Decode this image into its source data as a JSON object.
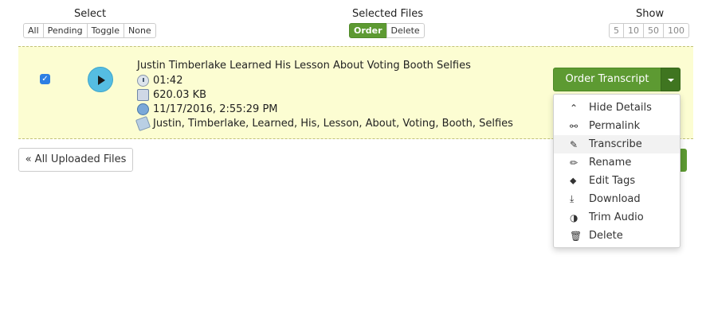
{
  "toolbar": {
    "select": {
      "title": "Select",
      "buttons": [
        "All",
        "Pending",
        "Toggle",
        "None"
      ]
    },
    "selected_files": {
      "title": "Selected Files",
      "buttons": [
        "Order",
        "Delete"
      ],
      "active": "Order"
    },
    "show": {
      "title": "Show",
      "buttons": [
        "5",
        "10",
        "50",
        "100"
      ]
    }
  },
  "file": {
    "checked": true,
    "title": "Justin Timberlake Learned His Lesson About Voting Booth Selfies",
    "duration": "01:42",
    "size": "620.03 KB",
    "date": "11/17/2016, 2:55:29 PM",
    "tags": "Justin, Timberlake, Learned, His, Lesson, About, Voting, Booth, Selfies"
  },
  "actions": {
    "order_label": "Order Transcript",
    "menu": [
      {
        "label": "Hide Details",
        "icon": "chevron-up-icon",
        "glyph": "⌃"
      },
      {
        "label": "Permalink",
        "icon": "link-icon",
        "glyph": "⚯"
      },
      {
        "label": "Transcribe",
        "icon": "edit-icon",
        "glyph": "✎"
      },
      {
        "label": "Rename",
        "icon": "pencil-icon",
        "glyph": "✏"
      },
      {
        "label": "Edit Tags",
        "icon": "tag-icon",
        "glyph": "⬥"
      },
      {
        "label": "Download",
        "icon": "download-icon",
        "glyph": "⤓"
      },
      {
        "label": "Trim Audio",
        "icon": "half-circle-icon",
        "glyph": "◑"
      },
      {
        "label": "Delete",
        "icon": "trash-icon",
        "glyph": "🗑"
      }
    ],
    "hovered": "Transcribe"
  },
  "nav": {
    "back_label": "« All Uploaded Files"
  },
  "colors": {
    "accent_green": "#5d9a32",
    "row_highlight": "#fcfdd2",
    "play_blue": "#55bde2"
  }
}
